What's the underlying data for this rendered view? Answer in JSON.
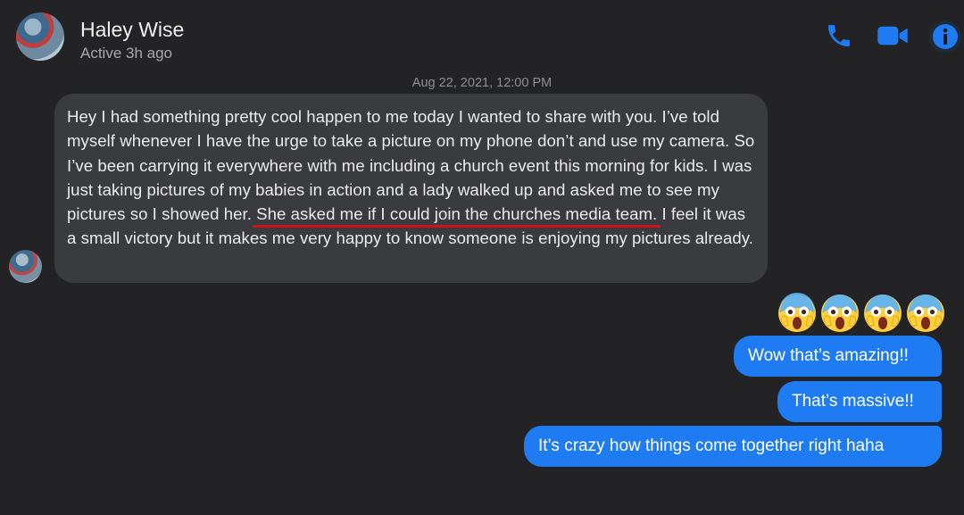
{
  "header": {
    "name": "Haley Wise",
    "status": "Active 3h ago",
    "icons": [
      "phone-icon",
      "video-icon",
      "info-icon"
    ],
    "accent_color": "#1f7bf2"
  },
  "conversation": {
    "timestamp": "Aug 22, 2021, 12:00 PM",
    "incoming": {
      "part1": "Hey I had something pretty cool happen to me today I wanted to share with you. I’ve told myself whenever I have the urge to take a picture on my phone don’t and use my camera. So I’ve been carrying it everywhere with me including a church event this morning for kids. I was just taking pictures of my babies in action and a lady walked up and asked me to see my pictures so I showed her. ",
      "highlight": "She asked me if I could join the churches media team.",
      "part2": " I feel it was a small victory but it makes me very happy to know someone is enjoying my pictures already."
    },
    "reactions": [
      "😱",
      "😱",
      "😱",
      "😱"
    ],
    "outgoing": [
      "Wow that’s amazing!!",
      "That’s massive!!",
      "It’s crazy how things come together right haha"
    ]
  }
}
